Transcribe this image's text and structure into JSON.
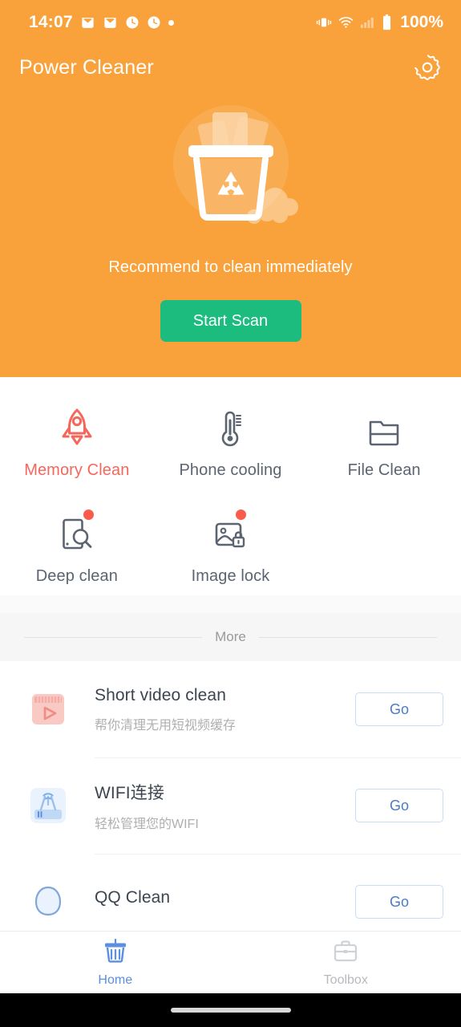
{
  "status_bar": {
    "time": "14:07",
    "battery_percent": "100%",
    "icons": [
      "mail-icon",
      "mail-icon",
      "clock-icon",
      "clock-icon",
      "dot-icon"
    ],
    "right_icons": [
      "vibrate-icon",
      "wifi-icon",
      "signal-icon",
      "battery-icon"
    ]
  },
  "header": {
    "title": "Power Cleaner",
    "settings_icon": "gear-icon"
  },
  "hero": {
    "illustration": "trash-can-icon",
    "caption": "Recommend to clean immediately",
    "scan_button": "Start Scan",
    "bg_color": "#F9A23C",
    "button_color": "#1BBC7E"
  },
  "features": [
    {
      "label": "Memory Clean",
      "icon": "rocket-icon",
      "accent": true,
      "badge": false
    },
    {
      "label": "Phone cooling",
      "icon": "thermometer-icon",
      "accent": false,
      "badge": false
    },
    {
      "label": "File Clean",
      "icon": "folder-icon",
      "accent": false,
      "badge": false
    },
    {
      "label": "Deep clean",
      "icon": "phone-search-icon",
      "accent": false,
      "badge": true
    },
    {
      "label": "Image lock",
      "icon": "image-lock-icon",
      "accent": false,
      "badge": true
    }
  ],
  "more_divider": {
    "label": "More"
  },
  "list": [
    {
      "title": "Short video clean",
      "subtitle": "帮你清理无用短视频缓存",
      "icon": "video-clapper-icon",
      "action": "Go"
    },
    {
      "title": "WIFI连接",
      "subtitle": "轻松管理您的WIFI",
      "icon": "router-icon",
      "action": "Go"
    },
    {
      "title": "QQ Clean",
      "subtitle": "",
      "icon": "qq-icon",
      "action": "Go"
    }
  ],
  "bottom_nav": [
    {
      "label": "Home",
      "icon": "trash-bin-icon",
      "active": true
    },
    {
      "label": "Toolbox",
      "icon": "briefcase-icon",
      "active": false
    }
  ],
  "colors": {
    "accent_orange": "#F9A23C",
    "accent_green": "#1BBC7E",
    "accent_coral": "#F4675C",
    "accent_blue": "#5B8FE0",
    "badge_red": "#FA5B4B"
  }
}
